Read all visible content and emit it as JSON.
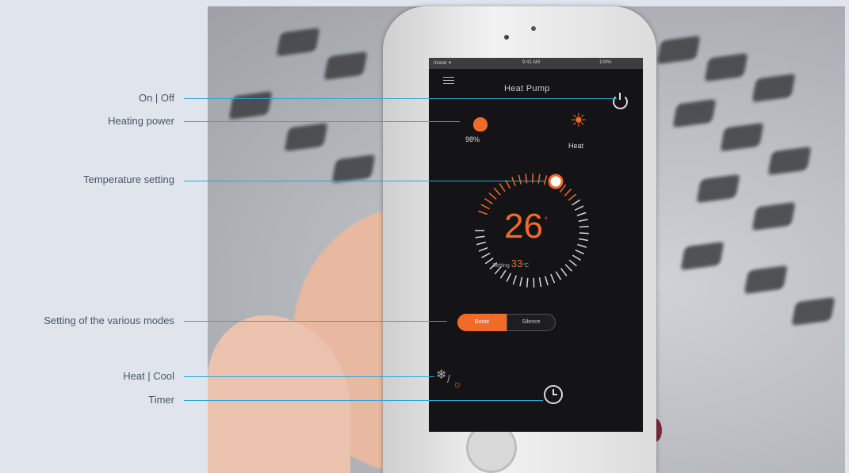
{
  "callouts": {
    "on_off": "On | Off",
    "heating_power": "Heating power",
    "temperature_setting": "Temperature setting",
    "modes": "Setting of the various modes",
    "heat_cool": "Heat | Cool",
    "timer": "Timer"
  },
  "app": {
    "title": "Heat Pump",
    "status_carrier": "Inland ✦",
    "status_time": "9:41 AM",
    "status_battery": "100%",
    "heating_power_value": "98%",
    "mode_label": "Heat",
    "current_temp": "26",
    "temp_unit": "°",
    "setting_label": "Setting",
    "setting_value": "33",
    "setting_unit": "°C",
    "mode_buttons": {
      "active": "Boost",
      "inactive": "Silence"
    }
  },
  "colors": {
    "accent": "#f06a2a",
    "callout_line": "#2aa6d9",
    "background": "#dfe4ed"
  },
  "icons": [
    "menu-icon",
    "power-icon",
    "flame-icon",
    "sun-icon",
    "snowflake-icon",
    "timer-icon"
  ]
}
